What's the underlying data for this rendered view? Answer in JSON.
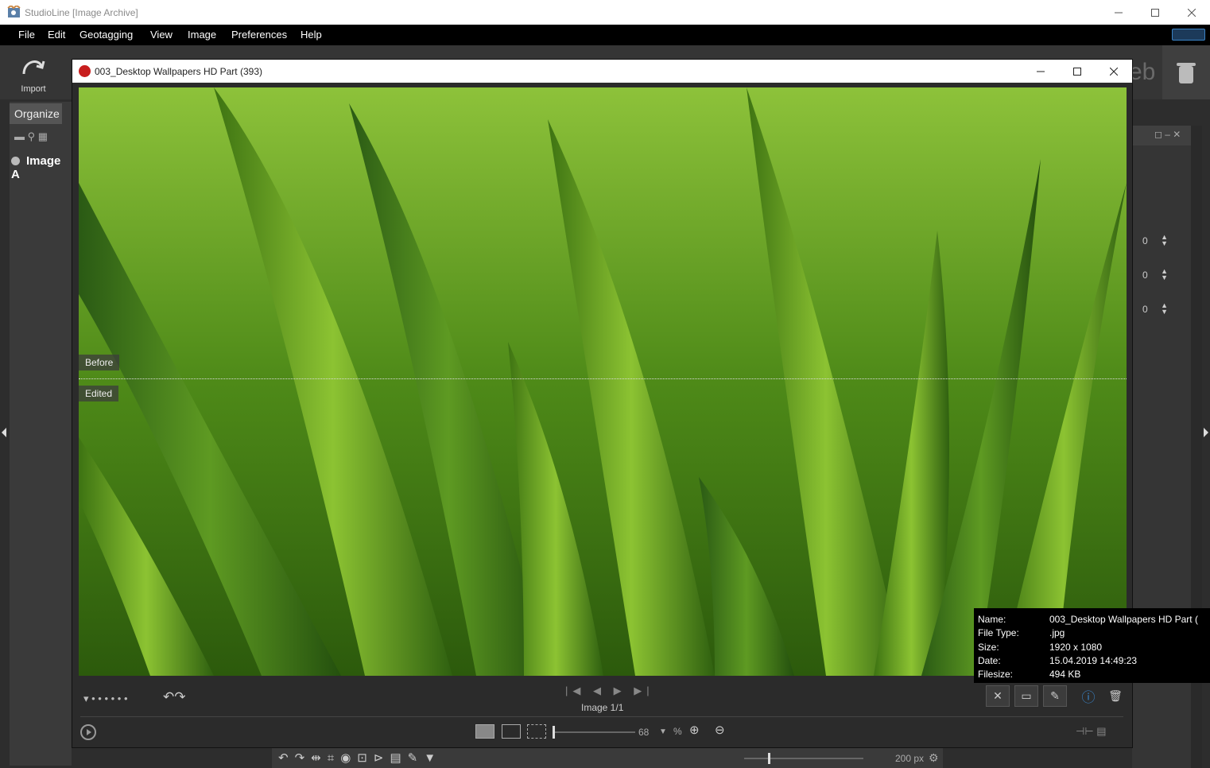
{
  "app": {
    "title": "StudioLine [Image Archive]"
  },
  "menu": [
    "File",
    "Edit",
    "Geotagging",
    "View",
    "Image",
    "Preferences",
    "Help"
  ],
  "toolbar": {
    "import_label": "Import",
    "web_fragment": "eb"
  },
  "left_panel": {
    "tab_label": "Organize",
    "tree_item": "Image A"
  },
  "right_panel": {
    "spin_values": [
      "0",
      "0",
      "0"
    ]
  },
  "viewer": {
    "title": "003_Desktop Wallpapers  HD Part (393)",
    "before_label": "Before",
    "edited_label": "Edited",
    "nav_glyphs": "|◀ ◀ ▶ ▶|",
    "image_counter": "Image 1/1",
    "zoom_value": "68",
    "zoom_unit": "%",
    "zoom_fraction": 0.0
  },
  "info_tooltip": {
    "rows": [
      {
        "label": "Name:",
        "value": "003_Desktop Wallpapers  HD Part ("
      },
      {
        "label": "File Type:",
        "value": ".jpg"
      },
      {
        "label": "Size:",
        "value": "1920 x 1080"
      },
      {
        "label": "Date:",
        "value": "15.04.2019 14:49:23"
      },
      {
        "label": "Filesize:",
        "value": "494 KB"
      }
    ]
  },
  "bottom_bar": {
    "thumb_size": "200 px"
  },
  "colors": {
    "accent": "#3a82c4",
    "grass_dark": "#2f5f0e",
    "grass_light": "#9acb2b"
  }
}
